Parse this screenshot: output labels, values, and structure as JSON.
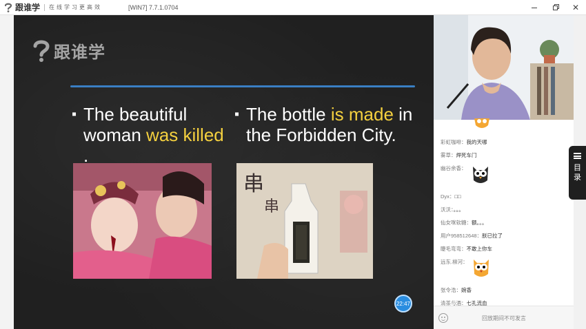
{
  "window": {
    "app_name": "跟谁学",
    "tagline": "在线学习更高效",
    "version": "[WIN7] 7.7.1.0704",
    "minimize_icon": "minimize-icon",
    "restore_icon": "restore-icon",
    "close_icon": "close-icon"
  },
  "slide": {
    "watermark": "跟谁学",
    "left_bullet": {
      "part1": "The beautiful woman ",
      "highlight": "was killed",
      "part2": " ."
    },
    "right_bullet": {
      "part1": "The bottle ",
      "highlight1": "is made",
      "part2": " in the Forbidden City."
    },
    "timer": "22:47",
    "accent_color": "#f4d03f",
    "rule_color": "#3a7fc4"
  },
  "chat": {
    "messages": [
      {
        "nick": "彩虹咖啡：",
        "text": "我的天哪"
      },
      {
        "nick": "雾草：",
        "text": "焊死车门"
      },
      {
        "nick": "幽谷余香：",
        "text": ""
      },
      {
        "nick": "Dyx：",
        "text": "□□"
      },
      {
        "nick": "沃沃：",
        "text": "。。。"
      },
      {
        "nick": "仙女咪软糖：",
        "text": "额。。。"
      },
      {
        "nick": "用户958512648：",
        "text": "朕已拉了"
      },
      {
        "nick": "睫毛弯弯：",
        "text": "不敢上你车"
      },
      {
        "nick": "远东.柳河：",
        "text": ""
      },
      {
        "nick": "张令浩：",
        "text": "婉香"
      },
      {
        "nick": "清茶与酒：",
        "text": "七孔流血"
      }
    ],
    "footer_hint": "回放期间不可发言"
  },
  "toc": {
    "label": "目录"
  }
}
